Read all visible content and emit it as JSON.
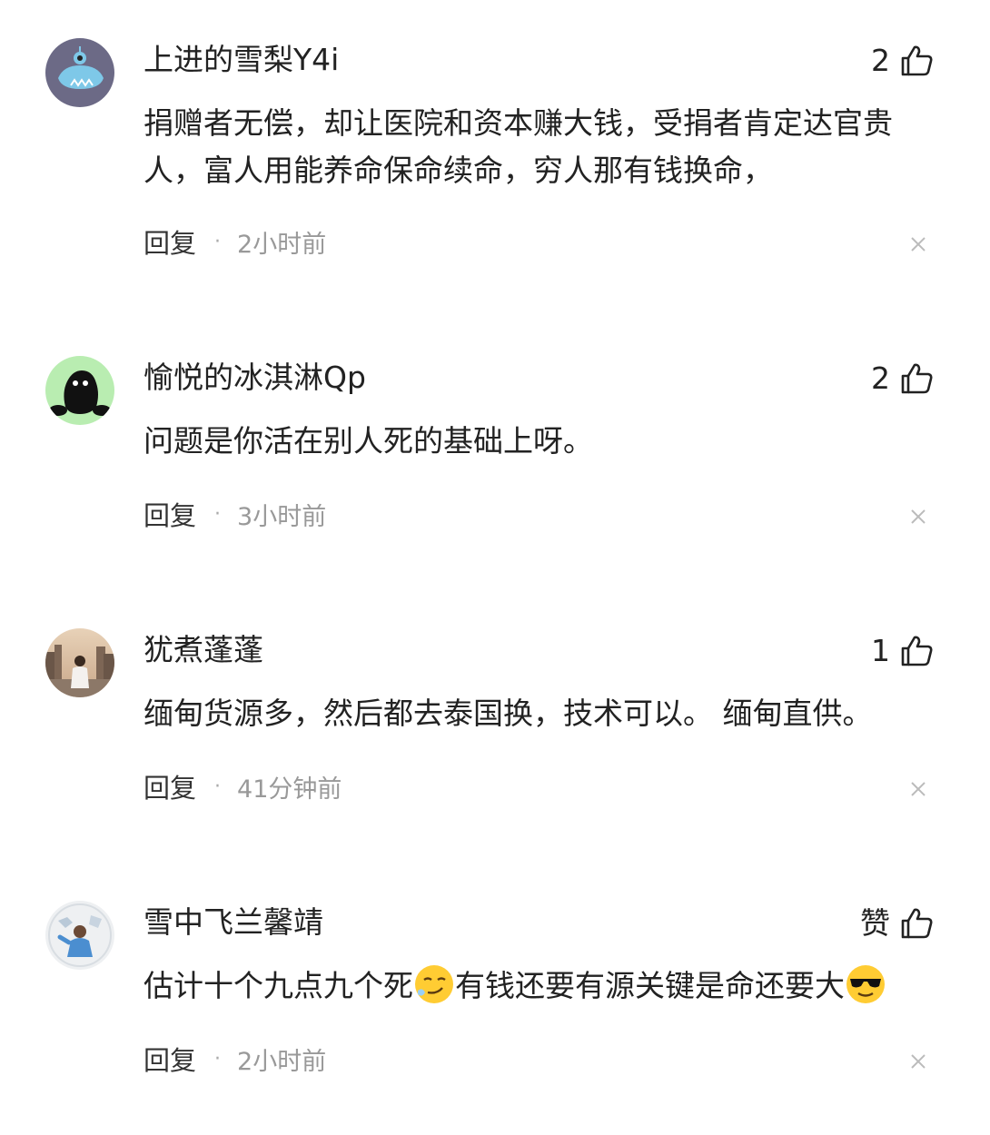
{
  "comments": [
    {
      "username": "上进的雪梨Y4i",
      "likes": "2",
      "content": "捐赠者无偿，却让医院和资本赚大钱，受捐者肯定达官贵人，富人用能养命保命续命，穷人那有钱换命，",
      "reply_label": "回复",
      "separator": "·",
      "time": "2小时前",
      "avatar_icon": "blue-monster-avatar-icon"
    },
    {
      "username": "愉悦的冰淇淋Qp",
      "likes": "2",
      "content": "问题是你活在别人死的基础上呀。",
      "reply_label": "回复",
      "separator": "·",
      "time": "3小时前",
      "avatar_icon": "black-blob-avatar-icon"
    },
    {
      "username": "犹煮蓬蓬",
      "likes": "1",
      "content": "缅甸货源多，然后都去泰国换，技术可以。 缅甸直供。",
      "reply_label": "回复",
      "separator": "·",
      "time": "41分钟前",
      "avatar_icon": "photo-avatar-icon"
    },
    {
      "username": "雪中飞兰馨靖",
      "likes": "赞",
      "content_part1": "估计十个九点九个死",
      "content_part2": "有钱还要有源关键是命还要大",
      "reply_label": "回复",
      "separator": "·",
      "time": "2小时前",
      "avatar_icon": "person-photo-avatar-icon"
    }
  ],
  "icons": {
    "like": "thumbs-up-icon",
    "close": "close-icon",
    "emoji1": "smirk-emoji-icon",
    "emoji2": "sunglasses-emoji-icon"
  },
  "colors": {
    "text": "#222222",
    "time": "#999999",
    "avatar_blue_bg": "#6b6b8a",
    "avatar_green_bg": "#b8ecb0"
  }
}
